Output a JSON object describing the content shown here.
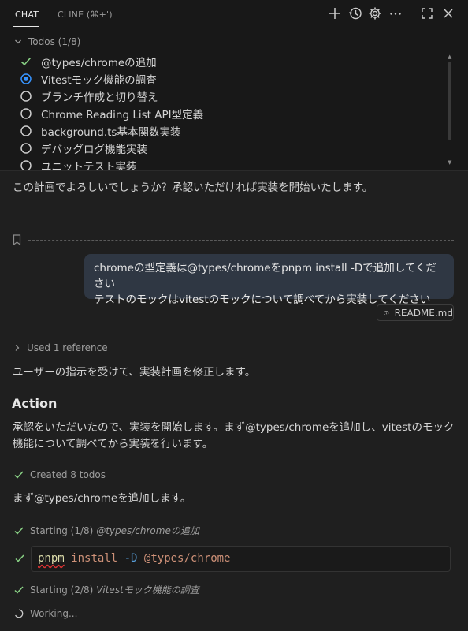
{
  "tabs": {
    "chat": "CHAT",
    "cline": "CLINE (⌘+')"
  },
  "toolbar_icons": [
    "plus-icon",
    "history-icon",
    "gear-icon",
    "ellipsis-icon",
    "maximize-icon",
    "close-icon"
  ],
  "todos": {
    "header": "Todos (1/8)",
    "items": [
      {
        "label": "@types/chromeの追加",
        "status": "done"
      },
      {
        "label": "Vitestモック機能の調査",
        "status": "in-progress"
      },
      {
        "label": "ブランチ作成と切り替え",
        "status": "pending"
      },
      {
        "label": "Chrome Reading List API型定義",
        "status": "pending"
      },
      {
        "label": "background.ts基本関数実装",
        "status": "pending"
      },
      {
        "label": "デバッグログ機能実装",
        "status": "pending"
      },
      {
        "label": "ユニットテスト実装",
        "status": "pending"
      }
    ]
  },
  "chat": {
    "prior_text": "この計画でよろしいでしょうか？承認いただければ実装を開始いたします。",
    "user_message": {
      "line1": "chromeの型定義は@types/chromeをpnpm install -Dで追加してください",
      "line2": "テストのモックはvitestのモックについて調べてから実装してください"
    },
    "attachment": "README.md",
    "reference": "Used 1 reference",
    "reply_intro": "ユーザーの指示を受けて、実装計画を修正します。",
    "action_heading": "Action",
    "action_line1": "承認をいただいたので、実装を開始します。まず@types/chromeを追加し、vitestのモック",
    "action_line2": "機能について調べてから実装を行います。",
    "created_todos": "Created 8 todos",
    "add_text": "まず@types/chromeを追加します。",
    "step1_prefix": "Starting (1/8) ",
    "step1_task": "@types/chromeの追加",
    "code": {
      "cmd": "pnpm",
      "sub": "install",
      "flag": "-D",
      "pkg": "@types/chrome"
    },
    "step2_prefix": "Starting (2/8) ",
    "step2_task": "Vitestモック機能の調査",
    "working": "Working..."
  },
  "colors": {
    "accent": "#3794ff",
    "success": "#89d185",
    "bubble": "#2f3743",
    "background": "#1f1f1f"
  }
}
